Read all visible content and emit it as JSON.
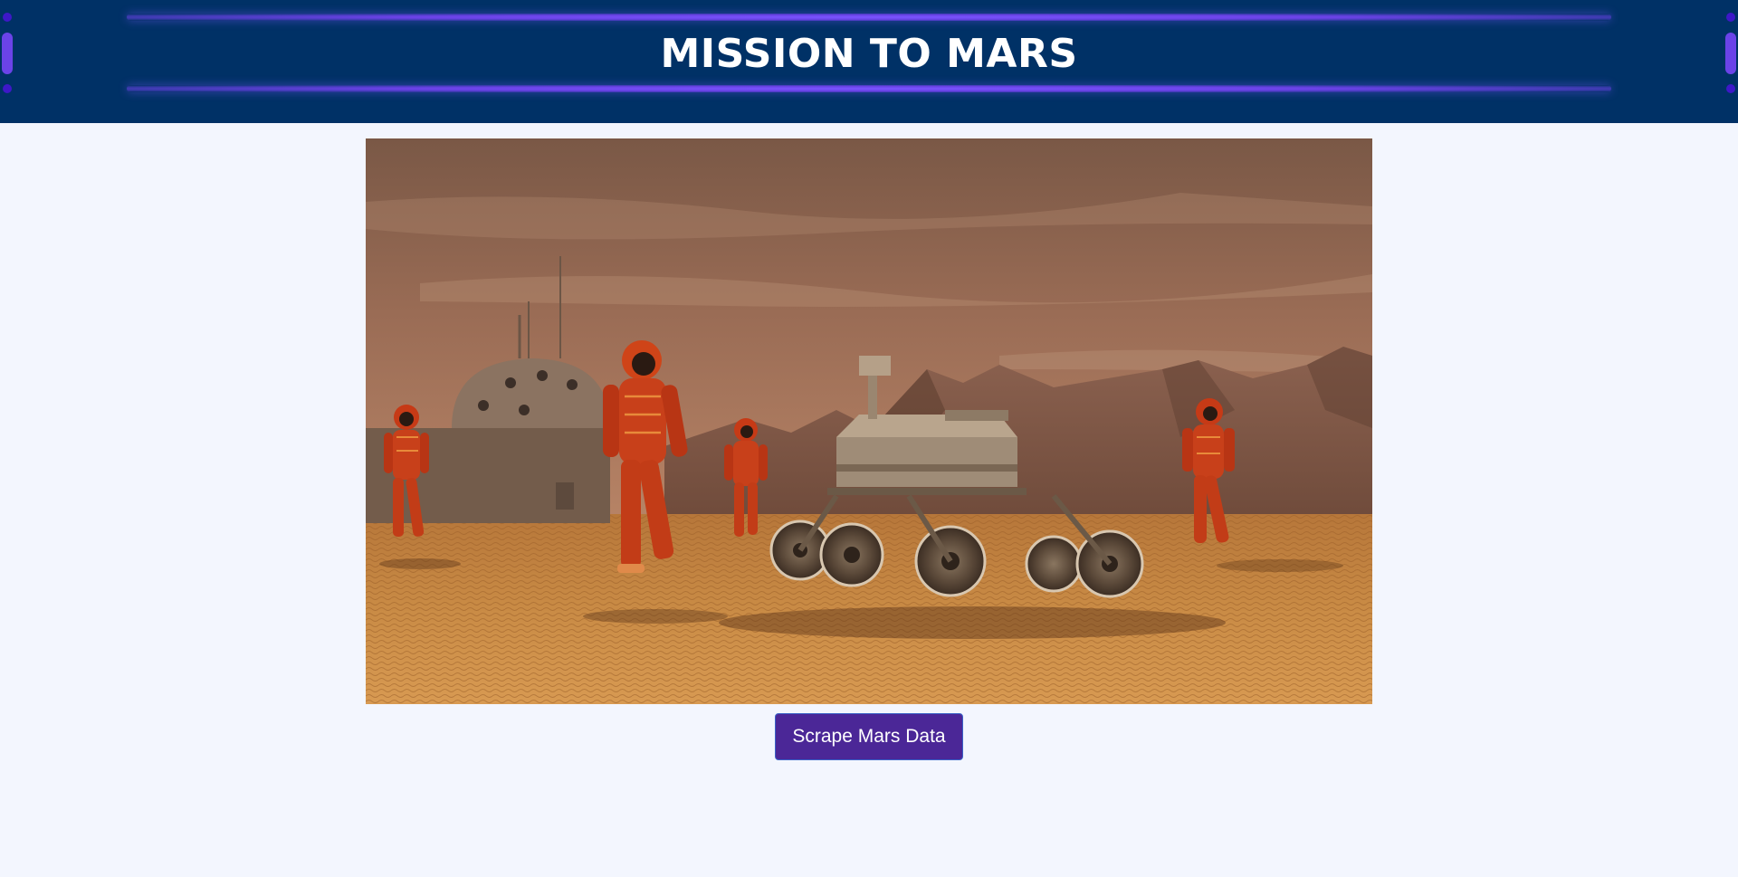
{
  "header": {
    "title": "MISSION TO MARS",
    "accent_color": "#6a42e6",
    "background_color": "#003166"
  },
  "hero": {
    "image_subject": "astronauts-and-rover-on-mars",
    "alt": ""
  },
  "actions": {
    "scrape_label": "Scrape Mars Data",
    "button_color": "#4b2797"
  }
}
